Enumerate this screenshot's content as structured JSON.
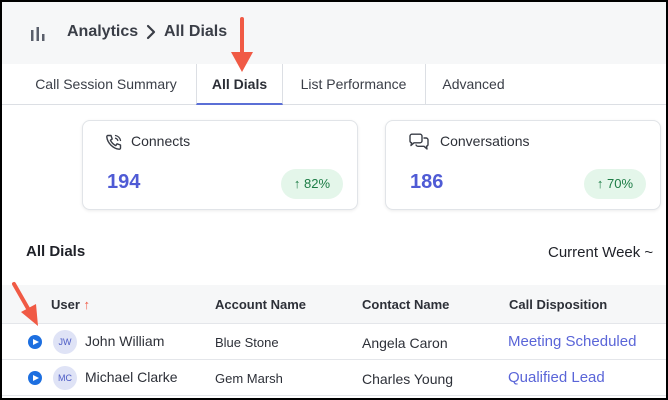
{
  "header": {
    "breadcrumb_root": "Analytics",
    "breadcrumb_current": "All Dials"
  },
  "tabs": [
    {
      "label": "Call Session Summary",
      "active": false
    },
    {
      "label": "All Dials",
      "active": true
    },
    {
      "label": "List Performance",
      "active": false
    },
    {
      "label": "Advanced",
      "active": false
    }
  ],
  "cards": [
    {
      "label": "Connects",
      "value": "194",
      "change": "82%",
      "icon": "phone-call-icon"
    },
    {
      "label": "Conversations",
      "value": "186",
      "change": "70%",
      "icon": "chat-bubbles-icon"
    }
  ],
  "section": {
    "title": "All Dials",
    "period": "Current Week ~"
  },
  "table": {
    "columns": [
      "User",
      "Account Name",
      "Contact Name",
      "Call Disposition"
    ],
    "rows": [
      {
        "initials": "JW",
        "user": "John William",
        "account": "Blue Stone",
        "contact": "Angela Caron",
        "disposition": "Meeting Scheduled"
      },
      {
        "initials": "MC",
        "user": "Michael Clarke",
        "account": "Gem Marsh",
        "contact": "Charles Young",
        "disposition": "Qualified Lead"
      }
    ]
  },
  "colors": {
    "accent": "#4f5bd5",
    "link": "#5a65d8",
    "success_bg": "#e4f6ea",
    "success_text": "#1c7c45",
    "annotation_arrow": "#f05a45",
    "play": "#1d6fe0"
  }
}
